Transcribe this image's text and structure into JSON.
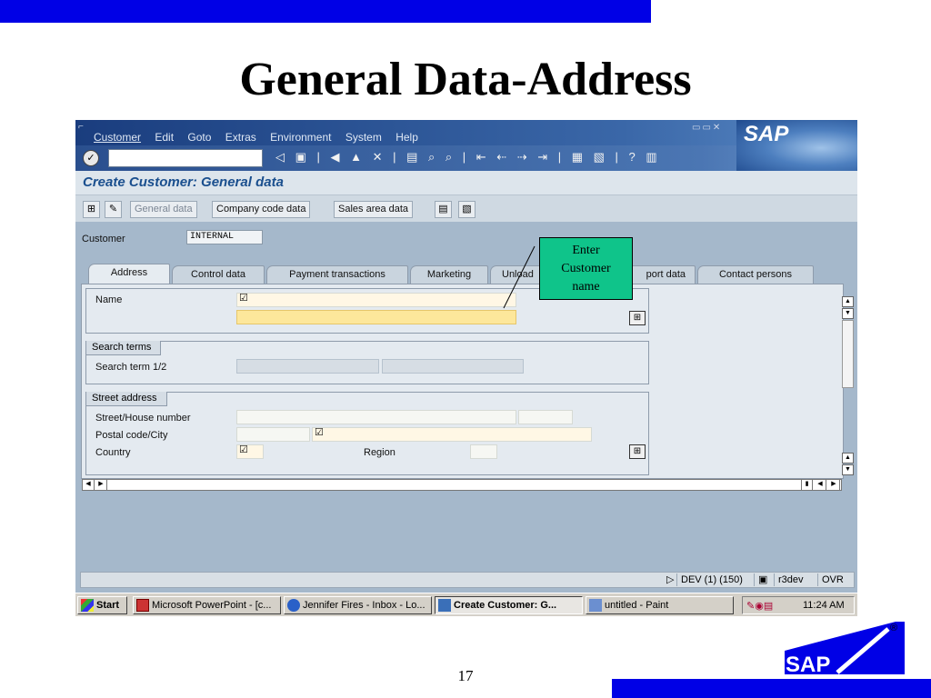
{
  "slide": {
    "title": "General Data-Address",
    "page_number": "17"
  },
  "menu": {
    "items": [
      "Customer",
      "Edit",
      "Goto",
      "Extras",
      "Environment",
      "System",
      "Help"
    ],
    "brand": "SAP"
  },
  "toolbar": {
    "command_value": ""
  },
  "screen": {
    "title": "Create Customer: General data"
  },
  "appbar": {
    "general_data": "General data",
    "company_code_data": "Company code data",
    "sales_area_data": "Sales area data"
  },
  "header": {
    "customer_label": "Customer",
    "customer_value": "INTERNAL"
  },
  "tabs": [
    "Address",
    "Control data",
    "Payment transactions",
    "Marketing",
    "Unload",
    "port data",
    "Contact persons"
  ],
  "form": {
    "name_label": "Name",
    "search_group": "Search terms",
    "search_label": "Search term 1/2",
    "street_group": "Street address",
    "street_label": "Street/House number",
    "postal_label": "Postal code/City",
    "country_label": "Country",
    "region_label": "Region",
    "check_mark": "☑"
  },
  "status": {
    "system": "DEV (1) (150)",
    "server": "r3dev",
    "mode": "OVR"
  },
  "taskbar": {
    "start": "Start",
    "tasks": [
      "Microsoft PowerPoint - [c...",
      "Jennifer Fires - Inbox - Lo...",
      "Create Customer: G...",
      "untitled - Paint"
    ],
    "time": "11:24 AM"
  },
  "callout": {
    "lines": [
      "Enter",
      "Customer",
      "name"
    ]
  },
  "logo": {
    "text": "SAP",
    "mark": "®"
  },
  "colors": {
    "slide_bar": "#0000e6",
    "callout": "#0fc48a",
    "active_field": "#fde79b"
  }
}
